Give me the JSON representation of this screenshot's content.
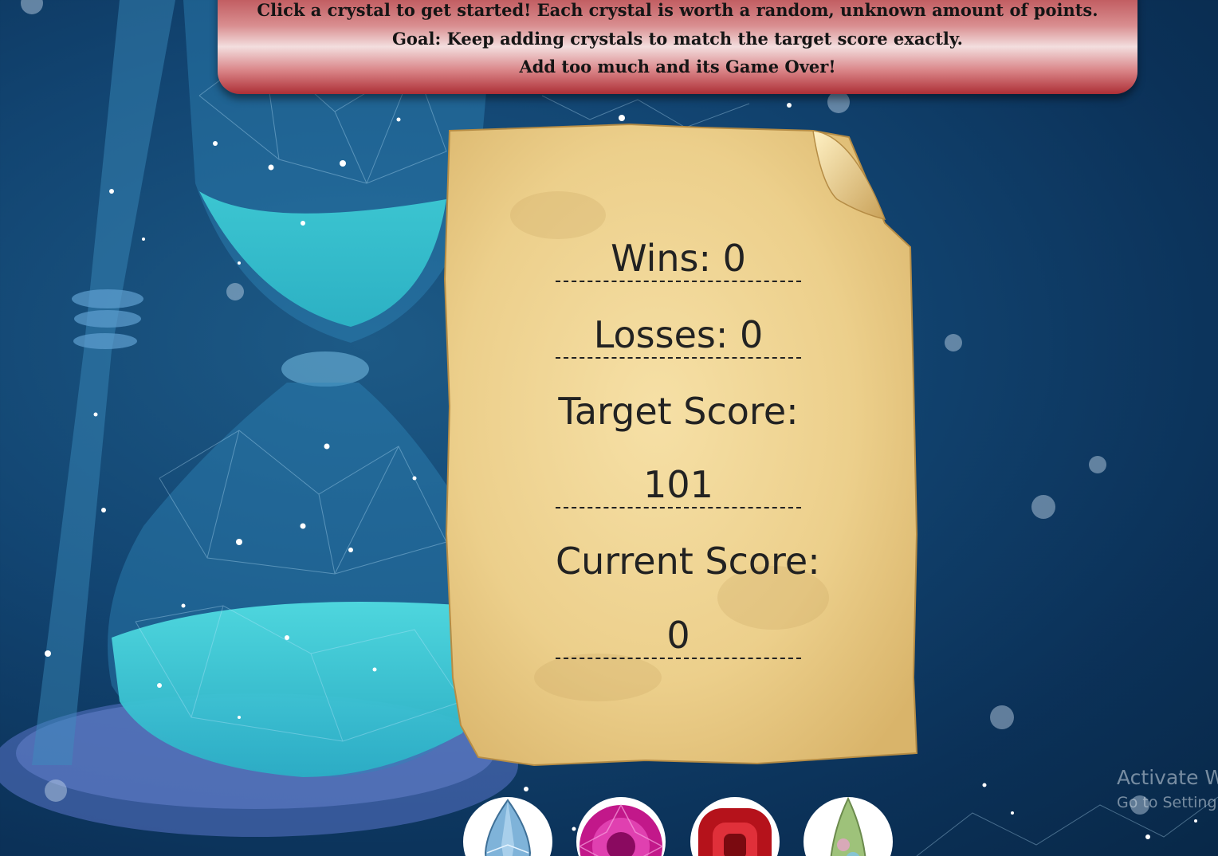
{
  "banner": {
    "line1": "Click a crystal to get started! Each crystal is worth a random, unknown amount of points.",
    "line2": "Goal: Keep adding crystals to match the target score exactly.",
    "line3": "Add too much and its Game Over!"
  },
  "scoreboard": {
    "wins_label": "Wins: 0",
    "losses_label": "Losses: 0",
    "target_label": "Target Score:",
    "target_value": "101",
    "current_label": "Current Score:",
    "current_value": "0"
  },
  "crystals": [
    {
      "name": "blue-crystal",
      "color": "#7fb3d9"
    },
    {
      "name": "pink-crystal",
      "color": "#c2188a"
    },
    {
      "name": "red-crystal",
      "color": "#b5121b"
    },
    {
      "name": "opal-crystal",
      "color": "#9ec27a"
    }
  ],
  "watermark": {
    "line1": "Activate W",
    "line2": "Go to Setting"
  },
  "colors": {
    "background": "#124572",
    "banner": "#c8666a",
    "parchment": "#eed597",
    "hourglass_sand": "#45d4dc"
  }
}
